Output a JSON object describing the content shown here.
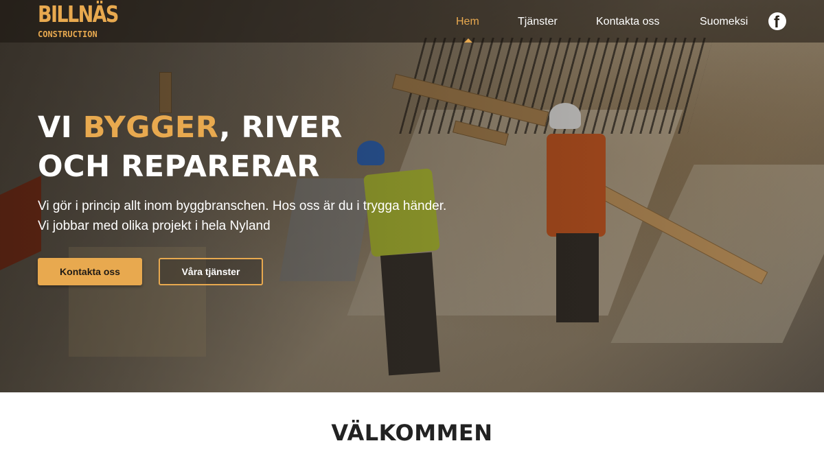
{
  "brand": {
    "logo_top": "BILLNÄS",
    "logo_bottom": "CONSTRUCTION",
    "accent_color": "#e8a94f"
  },
  "nav": {
    "items": [
      {
        "label": "Hem",
        "active": true
      },
      {
        "label": "Tjänster",
        "active": false
      },
      {
        "label": "Kontakta oss",
        "active": false
      },
      {
        "label": "Suomeksi",
        "active": false
      }
    ],
    "social_icon": "facebook-icon"
  },
  "hero": {
    "headline_part1": "VI ",
    "headline_accent": "BYGGER",
    "headline_part2": ", RIVER",
    "headline_line2": "OCH REPARERAR",
    "lead": "Vi gör i princip allt inom byggbranschen. Hos oss är du i trygga händer. Vi jobbar med olika projekt i hela Nyland",
    "primary_button": "Kontakta oss",
    "secondary_button": "Våra tjänster"
  },
  "welcome": {
    "title": "VÄLKOMMEN"
  }
}
